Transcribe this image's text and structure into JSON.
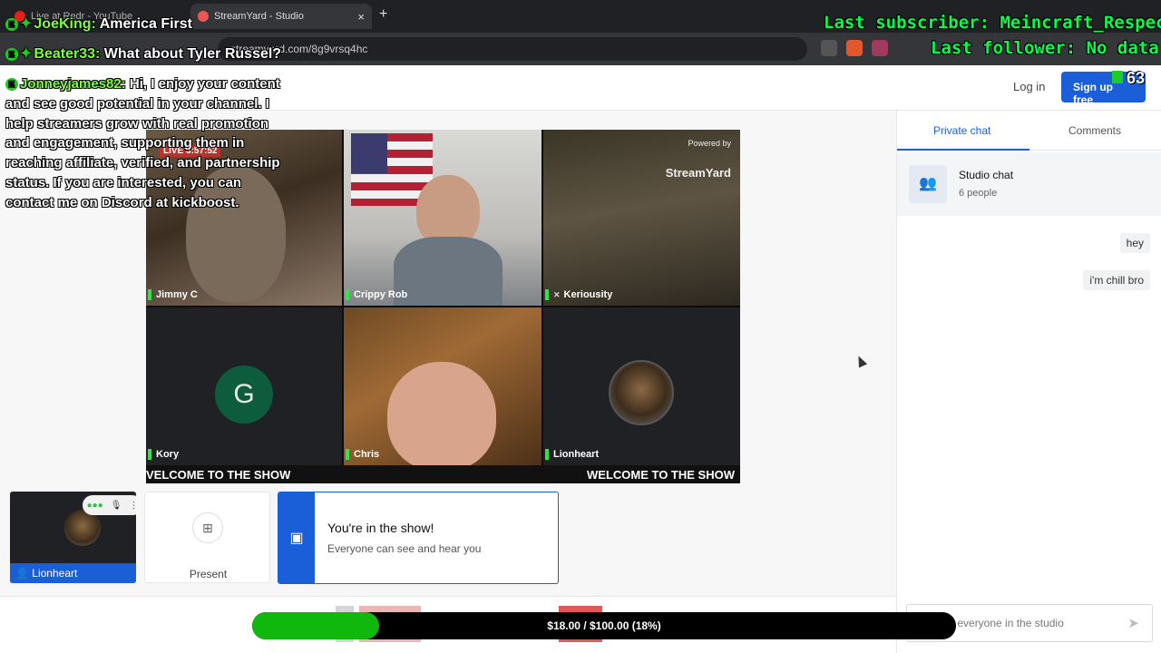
{
  "browser": {
    "tab_inactive": "Live at Redr - YouTube",
    "tab_active": "StreamYard - Studio",
    "tab_close": "×",
    "new_tab": "+",
    "url": "streamyard.com/8g9vrsq4hc"
  },
  "topnav": {
    "login": "Log in",
    "signup": "Sign up free"
  },
  "stage": {
    "live_badge": "LIVE 3:57:52",
    "watermark_top": "Powered by",
    "watermark_brand": "StreamYard",
    "participants": [
      "Jimmy C",
      "Crippy Rob",
      "Keriousity",
      "Kory",
      "Chris",
      "Lionheart"
    ],
    "kory_initial": "G",
    "ticker_left": "VELCOME TO THE SHOW",
    "ticker_right": "WELCOME TO THE SHOW"
  },
  "bottom": {
    "self_name": "Lionheart",
    "present_label": "Present",
    "inshow_title": "You're in the show!",
    "inshow_sub": "Everyone can see and hear you"
  },
  "chat": {
    "tab_private": "Private chat",
    "tab_comments": "Comments",
    "studio_title": "Studio chat",
    "studio_people": "6 people",
    "messages": [
      "hey",
      "i'm chill bro"
    ],
    "input_placeholder": "th everyone in the studio"
  },
  "overlay": {
    "chat_lines": [
      {
        "user": "JoeKing:",
        "text": "America First"
      },
      {
        "user": "Beater33:",
        "text": "What about Tyler Russel?"
      },
      {
        "user": "Jonneyjames82:",
        "text": "Hi, I enjoy your content and see good potential in your channel. I help streamers grow with real promotion and engagement, supporting them in reaching affiliate, verified, and partnership status. If you are interested, you can contact me on Discord at kickboost."
      }
    ],
    "last_subscriber": "Last subscriber: Meincraft_Respector",
    "last_follower": "Last follower: No data",
    "viewer_count": "63",
    "goal_text": "$18.00 / $100.00 (18%)",
    "goal_fraction": 0.18
  },
  "colors": {
    "accent": "#1a5fd8",
    "goal_fill": "#10b70c",
    "overlay_green": "#00ff4c"
  }
}
